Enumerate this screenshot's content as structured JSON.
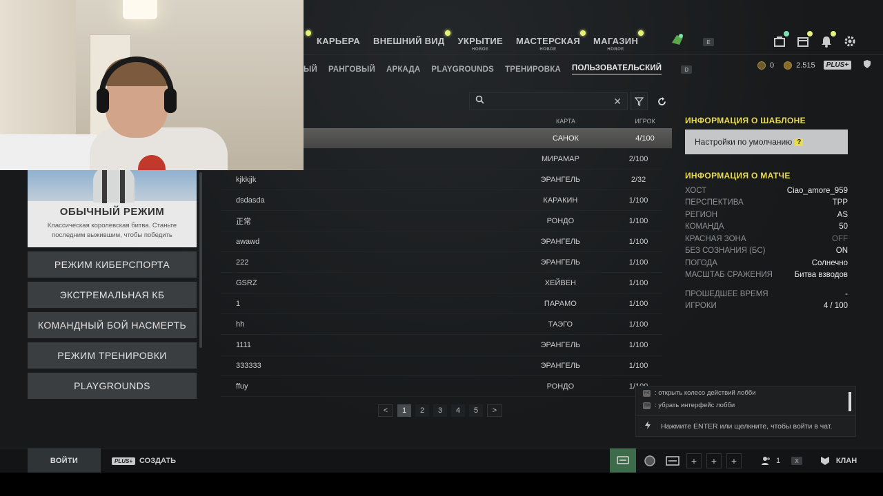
{
  "topnav": {
    "items": [
      {
        "label": "КАРЬЕРА",
        "badge": "",
        "dot": true
      },
      {
        "label": "ВНЕШНИЙ ВИД",
        "badge": "",
        "dot": true
      },
      {
        "label": "УКРЫТИЕ",
        "badge": "НОВОЕ",
        "dot": false
      },
      {
        "label": "МАСТЕРСКАЯ",
        "badge": "НОВОЕ",
        "dot": true
      },
      {
        "label": "МАГАЗИН",
        "badge": "НОВОЕ",
        "dot": true
      }
    ],
    "key_hint": "E",
    "accent": "#e6f17a"
  },
  "subnav": {
    "tabs": [
      "ЫЙ",
      "РАНГОВЫЙ",
      "АРКАДА",
      "PLAYGROUNDS",
      "ТРЕНИРОВКА",
      "ПОЛЬЗОВАТЕЛЬСКИЙ"
    ],
    "active": "ПОЛЬЗОВАТЕЛЬСКИЙ",
    "key_hint": "D"
  },
  "currency": {
    "coins": "0",
    "bp": "2.515",
    "plus": "PLUS+"
  },
  "search": {
    "value": "",
    "placeholder": ""
  },
  "table": {
    "headers": {
      "name": "",
      "map": "КАРТА",
      "players": "ИГРОК"
    },
    "rows": [
      {
        "name": "",
        "map": "САНОК",
        "players": "4/100"
      },
      {
        "name": "",
        "map": "МИРАМАР",
        "players": "2/100"
      },
      {
        "name": "kjkkjjk",
        "map": "ЭРАНГЕЛЬ",
        "players": "2/32"
      },
      {
        "name": "dsdasda",
        "map": "КАРАКИН",
        "players": "1/100"
      },
      {
        "name": "正常",
        "map": "РОНДО",
        "players": "1/100"
      },
      {
        "name": "awawd",
        "map": "ЭРАНГЕЛЬ",
        "players": "1/100"
      },
      {
        "name": "222",
        "map": "ЭРАНГЕЛЬ",
        "players": "1/100"
      },
      {
        "name": "GSRZ",
        "map": "ХЕЙВЕН",
        "players": "1/100"
      },
      {
        "name": "1",
        "map": "ПАРАМО",
        "players": "1/100"
      },
      {
        "name": "hh",
        "map": "ТАЭГО",
        "players": "1/100"
      },
      {
        "name": "1111",
        "map": "ЭРАНГЕЛЬ",
        "players": "1/100"
      },
      {
        "name": "333333",
        "map": "ЭРАНГЕЛЬ",
        "players": "1/100"
      },
      {
        "name": "ffuy",
        "map": "РОНДО",
        "players": "1/100"
      }
    ]
  },
  "pager": {
    "pages": [
      "1",
      "2",
      "3",
      "4",
      "5"
    ],
    "current": "1",
    "prev": "<",
    "next": ">"
  },
  "left": {
    "card_title": "ОБЫЧНЫЙ РЕЖИМ",
    "card_desc": "Классическая королевская битва. Станьте последним выжившим, чтобы победить",
    "modes": [
      "РЕЖИМ КИБЕРСПОРТА",
      "ЭКСТРЕМАЛЬНАЯ КБ",
      "КОМАНДНЫЙ БОЙ НАСМЕРТЬ",
      "РЕЖИМ ТРЕНИРОВКИ",
      "PLAYGROUNDS"
    ]
  },
  "info": {
    "template_title": "ИНФОРМАЦИЯ О ШАБЛОНЕ",
    "template_value": "Настройки по умолчанию",
    "template_help": "?",
    "match_title": "ИНФОРМАЦИЯ О МАТЧЕ",
    "rows": [
      {
        "k": "ХОСТ",
        "v": "Ciao_amore_959",
        "dim": false
      },
      {
        "k": "ПЕРСПЕКТИВА",
        "v": "TPP",
        "dim": false
      },
      {
        "k": "РЕГИОН",
        "v": "AS",
        "dim": false
      },
      {
        "k": "КОМАНДА",
        "v": "50",
        "dim": false
      },
      {
        "k": "КРАСНАЯ ЗОНА",
        "v": "OFF",
        "dim": true
      },
      {
        "k": "БЕЗ СОЗНАНИЯ (БС)",
        "v": "ON",
        "dim": false
      },
      {
        "k": "ПОГОДА",
        "v": "Солнечно",
        "dim": false
      },
      {
        "k": "МАСШТАБ СРАЖЕНИЯ",
        "v": "Битва взводов",
        "dim": false
      }
    ],
    "rows2": [
      {
        "k": "ПРОШЕДШЕЕ ВРЕМЯ",
        "v": "-",
        "dim": false
      },
      {
        "k": "ИГРОКИ",
        "v": "4 / 100",
        "dim": false
      }
    ],
    "title_color": "#e9dc54"
  },
  "chat": {
    "hint1": ": открыть колесо действий лобби",
    "hint2": ": убрать интерфейс лобби",
    "prompt": "Нажмите ENTER или щелкните, чтобы войти в чат."
  },
  "bottom": {
    "join": "ВОЙТИ",
    "create_badge": "PLUS+",
    "create": "СОЗДАТЬ",
    "party_count": "1",
    "key_hint": "X",
    "clan": "КЛАН",
    "chat_accent": "#3e6b4a"
  }
}
